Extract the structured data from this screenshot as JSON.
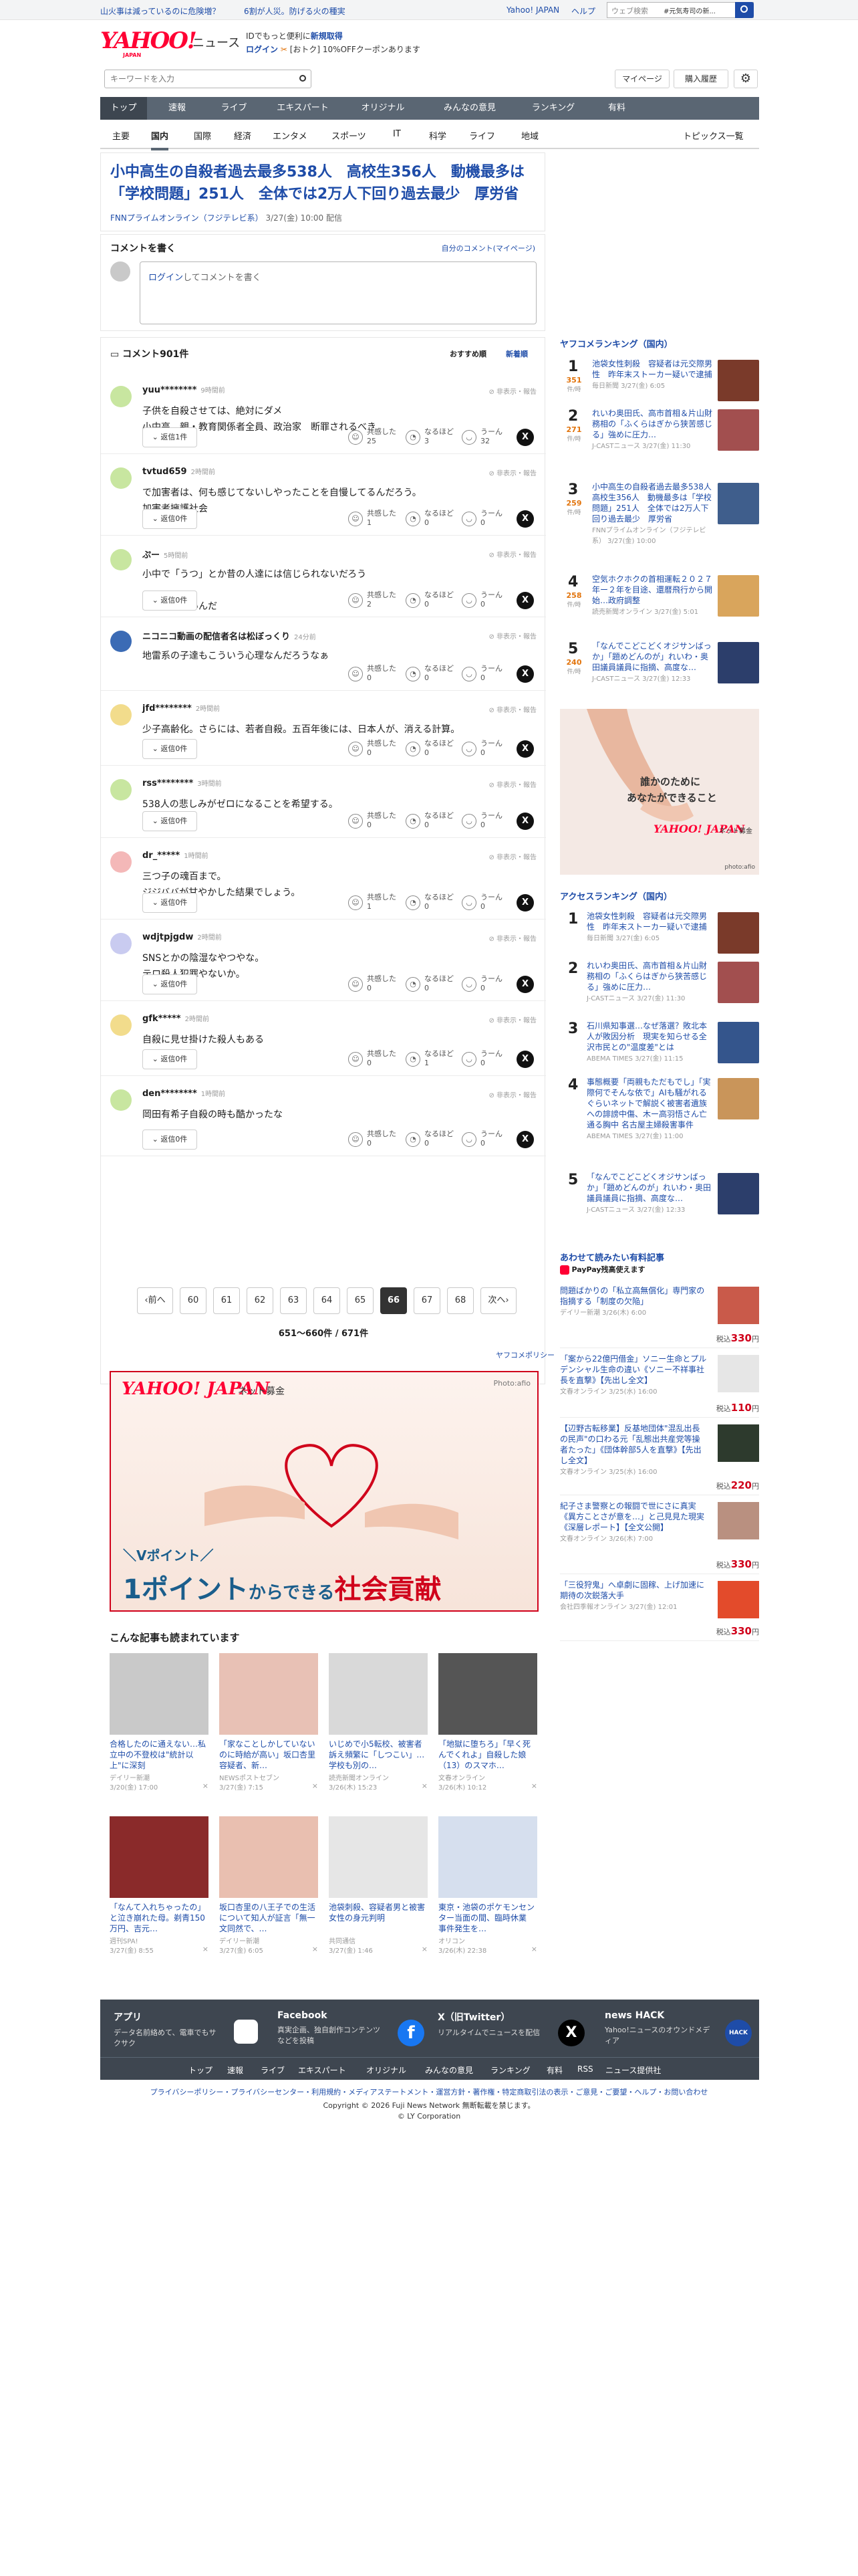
{
  "topbar": {
    "left_links": [
      "山火事は減っているのに危険増？",
      "6割が人災。防げる火の種実"
    ],
    "right_links": [
      "Yahoo! JAPAN",
      "ヘルプ"
    ],
    "search_placeholder": "ウェブ検索",
    "search_scope": "#元気寿司の新..."
  },
  "header": {
    "logo_text": "YAHOO!",
    "logo_sub": "JAPAN",
    "logo_news": "ニュース",
    "promo_line1_pre": "IDでもっと便利に",
    "promo_line1_link": "新規取得",
    "promo_line2_link": "ログイン",
    "promo_line2_post": "[おトク] 10%OFFクーポンあります"
  },
  "searchbar": {
    "placeholder": "キーワードを入力",
    "mypage": "マイページ",
    "subscription": "購入履歴"
  },
  "mainnav": [
    "トップ",
    "速報",
    "ライブ",
    "エキスパート",
    "オリジナル",
    "みんなの意見",
    "ランキング",
    "有料"
  ],
  "subnav": [
    "主要",
    "国内",
    "国際",
    "経済",
    "エンタメ",
    "スポーツ",
    "IT",
    "科学",
    "ライフ",
    "地域"
  ],
  "subnav_right": "トピックス一覧",
  "article": {
    "title": "小中高生の自殺者過去最多538人　高校生356人　動機最多は「学校問題」251人　全体では2万人下回り過去最少　厚労省",
    "source": "FNNプライムオンライン（フジテレビ系）",
    "date": "3/27(金) 10:00 配信"
  },
  "comment_post": {
    "heading": "コメントを書く",
    "my_comments": "自分のコメント(マイページ)",
    "login": "ログイン",
    "placeholder_rest": "してコメントを書く"
  },
  "comments_header": {
    "title": "コメント901件",
    "sort_recommended": "おすすめ順",
    "sort_newest": "新着順"
  },
  "comments": [
    {
      "user": "yuu********",
      "time": "9時間前",
      "lines": [
        "子供を自殺させては、絶対にダメ",
        "小中高　親・教育関係者全員、政治家　断罪されるべき"
      ],
      "reply": "返信1件",
      "agree": "25",
      "hmm": "3",
      "uun": "32"
    },
    {
      "user": "tvtud659",
      "time": "2時間前",
      "lines": [
        "で加害者は、何も感じてないしやったことを自慢してるんだろう。",
        "加害者擁護社会"
      ],
      "reply": "返信0件",
      "agree": "1",
      "hmm": "0",
      "uun": "0"
    },
    {
      "user": "ぷー",
      "time": "5時間前",
      "lines": [
        "小中で「うつ」とか昔の人達には信じられないだろう",
        "",
        "友達が少ないんだ"
      ],
      "reply": "返信0件",
      "agree": "2",
      "hmm": "0",
      "uun": "0"
    },
    {
      "user": "ニコニコ動画の配信者名は松ぼっくり",
      "time": "24分前",
      "lines": [
        "地雷系の子達もこういう心理なんだろうなぁ"
      ],
      "reply": "",
      "agree": "0",
      "hmm": "0",
      "uun": "0"
    },
    {
      "user": "jfd********",
      "time": "2時間前",
      "lines": [
        "少子高齢化。さらには、若者自殺。五百年後には、日本人が、消える計算。"
      ],
      "reply": "返信0件",
      "agree": "0",
      "hmm": "0",
      "uun": "0"
    },
    {
      "user": "rss********",
      "time": "3時間前",
      "lines": [
        "538人の悲しみがゼロになることを希望する。"
      ],
      "reply": "返信0件",
      "agree": "0",
      "hmm": "0",
      "uun": "0"
    },
    {
      "user": "dr_*****",
      "time": "1時間前",
      "lines": [
        "三つ子の魂百まで。",
        "ジジババが甘やかした結果でしょう。"
      ],
      "reply": "返信0件",
      "agree": "1",
      "hmm": "0",
      "uun": "0"
    },
    {
      "user": "wdjtpjgdw",
      "time": "2時間前",
      "lines": [
        "SNSとかの陰湿なやつやな。",
        "テロ殺人犯罪やないか。"
      ],
      "reply": "返信0件",
      "agree": "0",
      "hmm": "0",
      "uun": "0"
    },
    {
      "user": "gfk*****",
      "time": "2時間前",
      "lines": [
        "自殺に見せ掛けた殺人もある"
      ],
      "reply": "返信0件",
      "agree": "0",
      "hmm": "1",
      "uun": "0"
    },
    {
      "user": "den********",
      "time": "1時間前",
      "lines": [
        "岡田有希子自殺の時も酷かったな"
      ],
      "reply": "返信0件",
      "agree": "0",
      "hmm": "0",
      "uun": "0"
    }
  ],
  "reactions": {
    "agree": "共感した",
    "hmm": "なるほど",
    "uun": "うーん",
    "hide_report": "非表示・報告"
  },
  "pagination": {
    "prev": "前へ",
    "pages": [
      "60",
      "61",
      "62",
      "63",
      "64",
      "65",
      "66",
      "67",
      "68"
    ],
    "current": "66",
    "next": "次へ",
    "summary": "651〜660件 / 671件"
  },
  "ad_banner": {
    "policy": "ヤフコメポリシー",
    "brand": "YAHOO! JAPAN",
    "service": "ネット募金",
    "credit": "Photo:afio",
    "line1": "＼Vポイント／",
    "line2_a": "1ポイント",
    "line2_b": "からできる",
    "line2_c": "社会貢献"
  },
  "reading": {
    "heading": "こんな記事も読まれています",
    "cards": [
      {
        "title": "合格したのに通えない…私立中の不登校は\"統計以上\"に深刻",
        "source": "デイリー新潮",
        "date": "3/20(金) 17:00"
      },
      {
        "title": "「家なことしかしていないのに時給が高い」坂口杏里容疑者、新…",
        "source": "NEWSポストセブン",
        "date": "3/27(金) 7:15"
      },
      {
        "title": "いじめで小5転校、被害者訴え頻繁に「しつこい」…学校も別の…",
        "source": "読売新聞オンライン",
        "date": "3/26(木) 15:23"
      },
      {
        "title": "「地獄に堕ちろ」「早く死んでくれよ」自殺した娘（13）のスマホ…",
        "source": "文春オンライン",
        "date": "3/26(木) 10:12"
      },
      {
        "title": "「なんて入れちゃったの」と泣き崩れた母。剃青150万円、吉元…",
        "source": "週刊SPA!",
        "date": "3/27(金) 8:55"
      },
      {
        "title": "坂口杏里の八王子での生活について知人が証言「無一文同然で、…",
        "source": "デイリー新潮",
        "date": "3/27(金) 6:05"
      },
      {
        "title": "池袋刺殺、容疑者男と被害女性の身元判明",
        "source": "共同通信",
        "date": "3/27(金) 1:46"
      },
      {
        "title": "東京・池袋のポケモンセンター当面の間、臨時休業　事件発生を…",
        "source": "オリコン",
        "date": "3/26(木) 22:38"
      }
    ]
  },
  "ranking": {
    "heading": "ヤフコメランキング（国内）",
    "unit": "件/時",
    "items": [
      {
        "num": "1",
        "count": "351",
        "title": "池袋女性刺殺　容疑者は元交際男性　昨年末ストーカー疑いで逮捕",
        "source": "毎日新聞 3/27(金) 6:05"
      },
      {
        "num": "2",
        "count": "271",
        "title": "れいわ奥田氏、高市首相＆片山財務相の「ふくらはぎから狭苦感じる」強めに圧力…",
        "source": "J-CASTニュース 3/27(金) 11:30"
      },
      {
        "num": "3",
        "count": "259",
        "title": "小中高生の自殺者過去最多538人　高校生356人　動機最多は「学校問題」251人　全体では2万人下回り過去最少　厚労省",
        "source": "FNNプライムオンライン（フジテレビ系） 3/27(金) 10:00"
      },
      {
        "num": "4",
        "count": "258",
        "title": "空気ホクホクの首相運転２０２７年ー２年を目途、還暦飛行から開始…政府調整",
        "source": "読売新聞オンライン 3/27(金) 5:01"
      },
      {
        "num": "5",
        "count": "240",
        "title": "「なんでこどこどくオジサンばっか」「題めどんのが」れいわ・奥田議員議員に指摘、高度な…",
        "source": "J-CASTニュース 3/27(金) 12:33"
      }
    ]
  },
  "side_ad": {
    "line1": "誰かのために",
    "line2": "あなたができること",
    "brand": "YAHOO! JAPAN",
    "service": "ネット募金",
    "credit": "photo:afio"
  },
  "access_ranking": {
    "heading": "アクセスランキング（国内）",
    "items": [
      {
        "num": "1",
        "title": "池袋女性刺殺　容疑者は元交際男性　昨年末ストーカー疑いで逮捕",
        "source": "毎日新聞 3/27(金) 6:05"
      },
      {
        "num": "2",
        "title": "れいわ奥田氏、高市首相＆片山財務相の「ふくらはぎから狭苦感じる」強めに圧力…",
        "source": "J-CASTニュース 3/27(金) 11:30"
      },
      {
        "num": "3",
        "title": "石川県知事選…なぜ落選？敗北本人が敗因分析　現実を知らせる全沢市民との\"温度差\"とは",
        "source": "ABEMA TIMES 3/27(金) 11:15"
      },
      {
        "num": "4",
        "title": "事態概要「両親もただもでし」「実際何でそんな依で」AIも騒がれるぐらいネットで解説く被害者遺族への誹謗中傷、木ー高羽悟さん亡通る胸中 名古屋主婦殺害事件",
        "source": "ABEMA TIMES 3/27(金) 11:00"
      },
      {
        "num": "5",
        "title": "「なんでこどこどくオジサンばっか」「題めどんのが」れいわ・奥田議員議員に指摘、高度な…",
        "source": "J-CASTニュース 3/27(金) 12:33"
      }
    ]
  },
  "paid": {
    "heading": "あわせて読みたい有料記事",
    "paypay": "PayPay残高使えます",
    "items": [
      {
        "title": "問題ばかりの「私立高無償化」専門家の指摘する「制度の欠陥」",
        "source": "デイリー新潮 3/26(木) 6:00",
        "price": "330"
      },
      {
        "title": "「案から22億円借金」ソニー生命とプルデンシャル生命の違い《ソニー不祥事社長を直撃》【先出し全文】",
        "source": "文春オンライン 3/25(水) 16:00",
        "price": "110"
      },
      {
        "title": "【辺野古転移業】反基地団体\"混乱出長の民声\"の口わる元「乱態出共産党等操者たった」《団体幹部5人を直撃》【先出し全文】",
        "source": "文春オンライン 3/25(水) 16:00",
        "price": "220"
      },
      {
        "title": "紀子さま警察との報闘で世にさに真実《異方ことさが意を…」と己見見た現実《深層レポート】【全文公開】",
        "source": "文春オンライン 3/26(木) 7:00",
        "price": "330"
      },
      {
        "title": "「三役狩鬼」へ卓劇に固稼、上げ加速に期待の次鋭落大手",
        "source": "会社四季報オンライン 3/27(金) 12:01",
        "price": "330"
      }
    ],
    "price_prefix": "税込",
    "price_suffix": "円"
  },
  "appbar": [
    {
      "title": "アプリ",
      "desc": "データ名前絡めて、電車でもサクサク"
    },
    {
      "title": "Facebook",
      "desc": "真実企画、独自創作コンテンツなどを投稿"
    },
    {
      "title": "X（旧Twitter）",
      "desc": "リアルタイムでニュースを配信"
    },
    {
      "title": "news HACK",
      "desc": "Yahoo!ニュースのオウンドメディア"
    }
  ],
  "footnav": [
    "トップ",
    "速報",
    "ライブ",
    "エキスパート",
    "オリジナル",
    "みんなの意見",
    "ランキング",
    "有料",
    "RSS",
    "ニュース提供社"
  ],
  "footlinks": "プライバシーポリシー・プライバシーセンター・利用規約・メディアステートメント・運営方針・著作権・特定商取引法の表示・ご意見・ご要望・ヘルプ・お問い合わせ",
  "copyright1": "Copyright © 2026 Fuji News Network 無断転載を禁じます。",
  "copyright2": "© LY Corporation"
}
